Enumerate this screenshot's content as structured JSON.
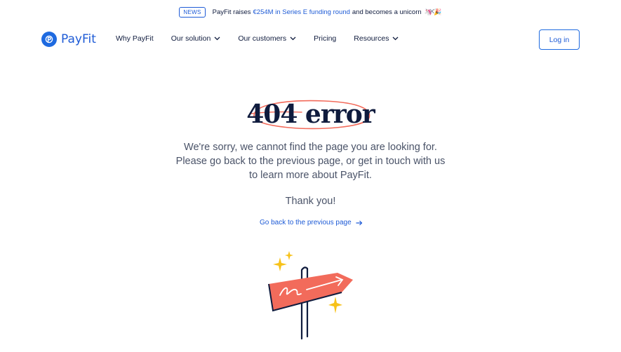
{
  "announcement": {
    "badge": "NEWS",
    "text_before": "PayFit raises",
    "link_text": "€254M in Series E funding round",
    "text_after": "and becomes a unicorn",
    "emoji": "🦄 🎉",
    "close_icon": "close-icon"
  },
  "header": {
    "brand": "PayFit",
    "nav": [
      {
        "label": "Why PayFit",
        "has_dropdown": false
      },
      {
        "label": "Our solution",
        "has_dropdown": true
      },
      {
        "label": "Our customers",
        "has_dropdown": true
      },
      {
        "label": "Pricing",
        "has_dropdown": false
      },
      {
        "label": "Resources",
        "has_dropdown": true
      }
    ],
    "login_label": "Log in"
  },
  "main": {
    "heading": "404 error",
    "message": "We're sorry, we cannot find the page you are looking for. Please go back to the previous page, or get in touch with us to learn more about PayFit.",
    "thanks": "Thank you!",
    "back_link": "Go back to the previous page"
  },
  "colors": {
    "brand_blue": "#1e5bd6",
    "navy_text": "#0f1b3d",
    "body_text": "#4a5368",
    "sign_coral": "#f26b5b",
    "sparkle_yellow": "#f7c21a"
  }
}
